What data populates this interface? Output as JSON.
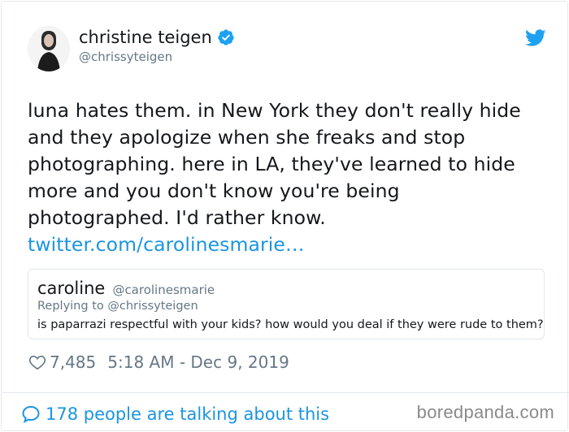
{
  "author": {
    "display_name": "christine teigen",
    "handle": "@chrissyteigen",
    "verified": true
  },
  "tweet": {
    "lines": [
      "luna hates them. in New York they don't really hide",
      "and they apologize when she freaks and stop",
      "photographing. here in LA, they've learned to hide",
      "more and you don't know you're being",
      "photographed. I'd rather know."
    ],
    "link": "twitter.com/carolinesmarie…"
  },
  "quoted": {
    "name": "caroline",
    "handle": "@carolinesmarie",
    "replying_to": "Replying to @chrissyteigen",
    "text": "is paparrazi respectful with your kids? how would you deal if they were rude to them?"
  },
  "meta": {
    "likes": "7,485",
    "timestamp": "5:18 AM - Dec 9, 2019"
  },
  "footer": {
    "talking": "178 people are talking about this",
    "watermark": "boredpanda.com"
  },
  "icons": {
    "verified": "verified-badge-icon",
    "brand": "twitter-bird-icon",
    "like": "heart-icon",
    "conversation": "speech-bubble-icon"
  },
  "colors": {
    "link_blue": "#1b95e0",
    "verified_blue": "#1da1f2",
    "muted_gray": "#657786",
    "text": "#14171a",
    "border": "#e1e8ed"
  }
}
